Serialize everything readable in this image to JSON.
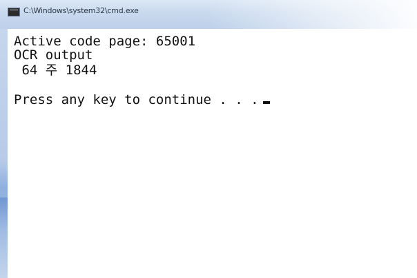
{
  "window": {
    "title": "C:\\Windows\\system32\\cmd.exe",
    "icon": "console-icon"
  },
  "console": {
    "lines": [
      "Active code page: 65001",
      "OCR output",
      " 64 주 1844",
      "",
      "Press any key to continue . . ."
    ]
  },
  "colors": {
    "titlebar": "#c9d9ee",
    "console_bg": "#ffffff",
    "console_text": "#111111"
  }
}
